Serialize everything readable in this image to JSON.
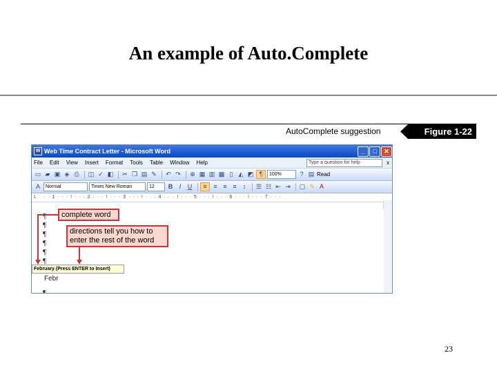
{
  "slide": {
    "title": "An example of Auto.Complete",
    "page_number": "23"
  },
  "figure": {
    "caption": "AutoComplete suggestion",
    "label": "Figure 1-22"
  },
  "window": {
    "title": "Web Time Contract Letter - Microsoft Word",
    "controls": {
      "minimize": "_",
      "maximize": "□",
      "close": "✕"
    },
    "menu": [
      "File",
      "Edit",
      "View",
      "Insert",
      "Format",
      "Tools",
      "Table",
      "Window",
      "Help"
    ],
    "help_box_placeholder": "Type a question for help",
    "menu_close": "x",
    "standard_toolbar": {
      "zoom": "100%",
      "read_label": "Read"
    },
    "formatting_toolbar": {
      "style": "Normal",
      "font": "Times New Roman",
      "size": "12",
      "bold": "B",
      "italic": "I",
      "underline": "U"
    },
    "ruler_text": "L · · · 1 · · · ! · · · 2 · · · ! · · · 3 · · · ! · · · 4 · · · ! · · · 5 · · · ! · · · 6 · · · ! · · · 7 · · ·",
    "pilcrow": "¶",
    "tooltip": "February  (Press ENTER to Insert)",
    "typed_text": "Febr"
  },
  "callouts": {
    "complete_word": "complete word",
    "directions": "directions tell you how to enter the rest of the word"
  },
  "colors": {
    "titlebar": "#0a49c4",
    "callout_border": "#cc3333",
    "callout_fill": "#fbd7d0",
    "tooltip_fill": "#fffdd8"
  }
}
